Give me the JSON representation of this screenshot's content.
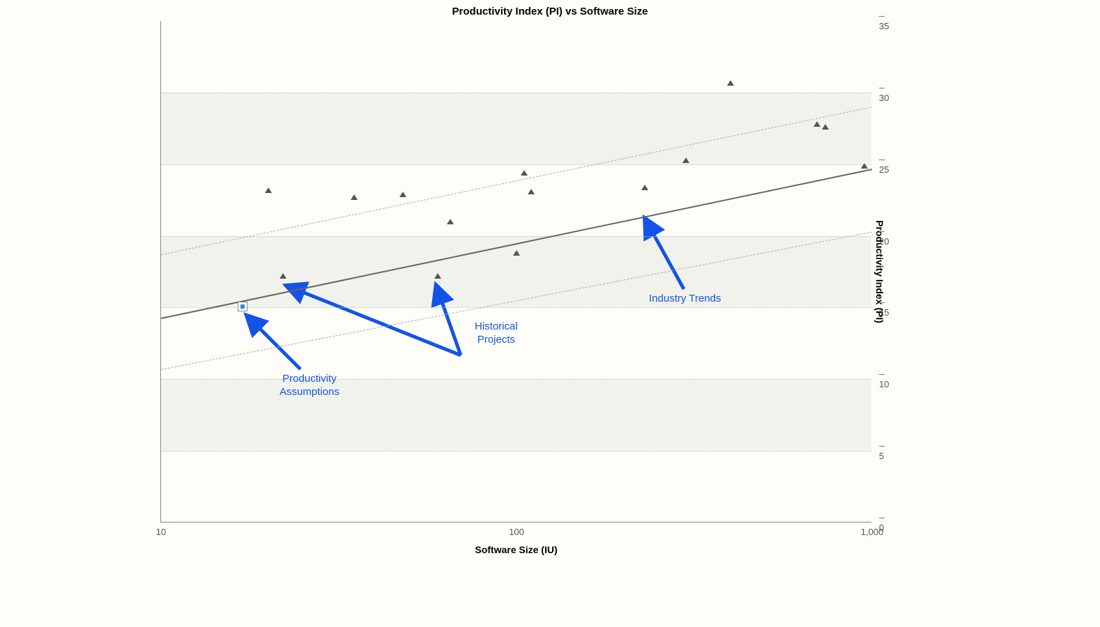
{
  "chart_data": {
    "type": "scatter",
    "title": "Productivity Index (PI) vs Software Size",
    "xlabel": "Software Size (IU)",
    "ylabel": "Productivity Index (PI)",
    "x_scale": "log",
    "xlim": [
      10,
      1000
    ],
    "ylim": [
      0,
      35
    ],
    "x_ticks": [
      10,
      100,
      1000
    ],
    "x_tick_labels": [
      "10",
      "100",
      "1,000"
    ],
    "y_ticks": [
      0,
      5,
      10,
      15,
      20,
      25,
      30,
      35
    ],
    "series": [
      {
        "name": "Historical Projects",
        "marker": "triangle",
        "points": [
          {
            "x": 20,
            "y": 23
          },
          {
            "x": 22,
            "y": 17
          },
          {
            "x": 35,
            "y": 22.5
          },
          {
            "x": 48,
            "y": 22.7
          },
          {
            "x": 60,
            "y": 17
          },
          {
            "x": 65,
            "y": 20.8
          },
          {
            "x": 100,
            "y": 18.6
          },
          {
            "x": 105,
            "y": 24.2
          },
          {
            "x": 110,
            "y": 22.9
          },
          {
            "x": 230,
            "y": 23.2
          },
          {
            "x": 300,
            "y": 25.1
          },
          {
            "x": 400,
            "y": 30.5
          },
          {
            "x": 700,
            "y": 27.6
          },
          {
            "x": 740,
            "y": 27.4
          },
          {
            "x": 950,
            "y": 24.7
          }
        ]
      },
      {
        "name": "Productivity Assumptions",
        "marker": "square",
        "points": [
          {
            "x": 17,
            "y": 15
          }
        ]
      }
    ],
    "trend_lines": {
      "center": {
        "y_at_x10": 14.3,
        "y_at_x1000": 24.7,
        "style": "solid"
      },
      "upper": {
        "y_at_x10": 18.7,
        "y_at_x1000": 29.0,
        "style": "dashed"
      },
      "lower": {
        "y_at_x10": 10.7,
        "y_at_x1000": 20.3,
        "style": "dashed"
      }
    },
    "annotations": [
      {
        "label": "Productivity\nAssumptions",
        "target_series": "Productivity Assumptions"
      },
      {
        "label": "Historical\nProjects",
        "target_series": "Historical Projects"
      },
      {
        "label": "Industry Trends",
        "target": "trend_center"
      }
    ]
  },
  "labels": {
    "ann_productivity_line1": "Productivity",
    "ann_productivity_line2": "Assumptions",
    "ann_historical_line1": "Historical",
    "ann_historical_line2": "Projects",
    "ann_industry": "Industry Trends"
  }
}
